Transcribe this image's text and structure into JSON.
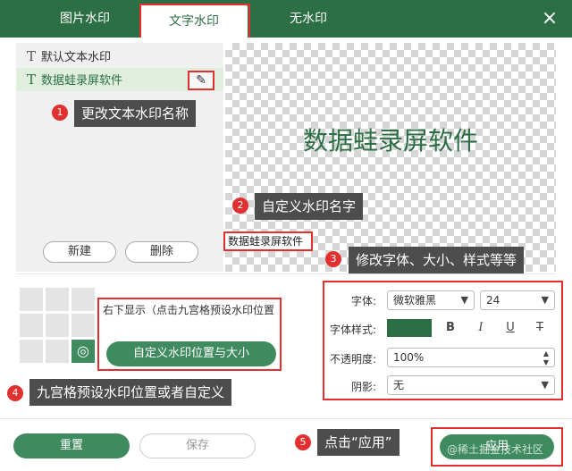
{
  "tabs": [
    {
      "label": "图片水印"
    },
    {
      "label": "文字水印"
    },
    {
      "label": "无水印"
    }
  ],
  "close_icon": "close-icon",
  "list": {
    "items": [
      {
        "label": "默认文本水印",
        "icon": "text-t-icon"
      },
      {
        "label": "数据蛙录屏软件",
        "icon": "text-t-icon"
      }
    ],
    "selected_index": 1,
    "edit_icon": "pencil-icon",
    "new_label": "新建",
    "delete_label": "删除"
  },
  "preview": {
    "text": "数据蛙录屏软件",
    "name_value": "数据蛙录屏软件"
  },
  "callouts": [
    {
      "num": "1",
      "text": "更改文本水印名称"
    },
    {
      "num": "2",
      "text": "自定义水印名字"
    },
    {
      "num": "3",
      "text": "修改字体、大小、样式等等"
    },
    {
      "num": "4",
      "text": "九宫格预设水印位置或者自定义"
    },
    {
      "num": "5",
      "text": "点击“应用”"
    }
  ],
  "position": {
    "grid_selected": "bottom-right",
    "hint": "右下显示（点击九宫格预设水印位置",
    "custom_button": "自定义水印位置与大小"
  },
  "font_settings": {
    "font_label": "字体:",
    "font_value": "微软雅黑",
    "size_value": "24",
    "style_label": "字体样式:",
    "color": "#2d6f44",
    "style_buttons": [
      "B",
      "I",
      "U",
      "T"
    ],
    "opacity_label": "不透明度:",
    "opacity_value": "100%",
    "shadow_label": "阴影:",
    "shadow_value": "无"
  },
  "footer": {
    "reset_label": "重置",
    "save_label": "保存",
    "apply_label": "应用",
    "watermark": "@稀土掘金技术社区"
  },
  "colors": {
    "brand_green": "#2d6f44",
    "annotation_red": "#e23030",
    "callout_bg": "#4d4d4d"
  }
}
